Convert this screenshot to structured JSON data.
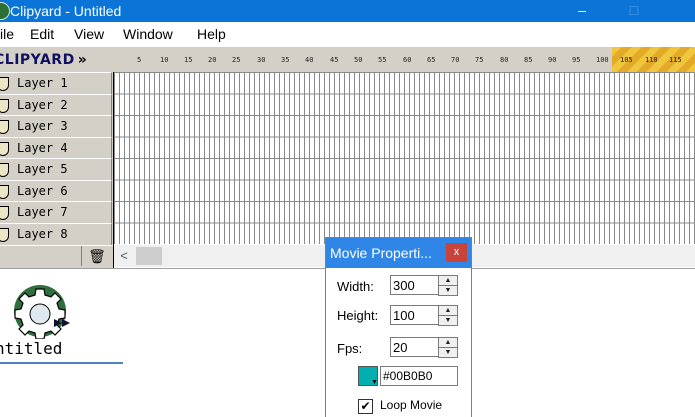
{
  "window": {
    "title": "Clipyard - Untitled",
    "minimize_glyph": "–",
    "maximize_glyph": "□",
    "accent": "#0b74d8"
  },
  "menu": [
    "ile",
    "Edit",
    "View",
    "Window",
    "Help"
  ],
  "ruler": {
    "logo": "CLIPYARD",
    "logo_chevron": "»",
    "ticks": [
      "5",
      "10",
      "15",
      "20",
      "25",
      "30",
      "35",
      "40",
      "45",
      "50",
      "55",
      "60",
      "65",
      "70",
      "75",
      "80",
      "85",
      "90",
      "95",
      "100",
      "105",
      "110",
      "115"
    ]
  },
  "layers": [
    "Layer 1",
    "Layer 2",
    "Layer 3",
    "Layer 4",
    "Layer 5",
    "Layer 6",
    "Layer 7",
    "Layer 8"
  ],
  "layers_toolbar": {
    "trash_glyph": "🗑"
  },
  "scrollbar": {
    "left_arrow": "<"
  },
  "workspace": {
    "movie_name": "ntitled"
  },
  "dialog": {
    "title": "Movie Properti...",
    "close_glyph": "x",
    "width_label": "Width:",
    "width_value": "300",
    "height_label": "Height:",
    "height_value": "100",
    "fps_label": "Fps:",
    "fps_value": "20",
    "color_hex": "#00B0B0",
    "background_color": "#00b0b0",
    "loop_label": "Loop Movie",
    "loop_checked": true,
    "checkmark": "✔",
    "spin_up": "▲",
    "spin_down": "▼",
    "dropdown_glyph": "▼"
  }
}
